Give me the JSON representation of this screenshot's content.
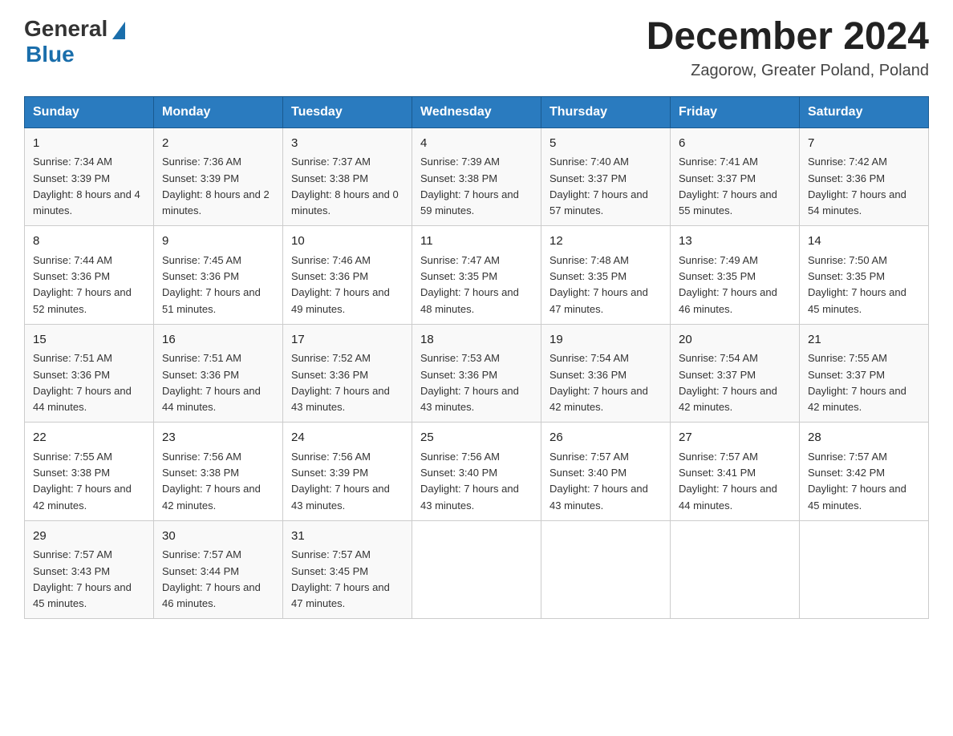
{
  "header": {
    "logo_general": "General",
    "logo_blue": "Blue",
    "title": "December 2024",
    "subtitle": "Zagorow, Greater Poland, Poland"
  },
  "weekdays": [
    "Sunday",
    "Monday",
    "Tuesday",
    "Wednesday",
    "Thursday",
    "Friday",
    "Saturday"
  ],
  "weeks": [
    [
      {
        "day": "1",
        "sunrise": "7:34 AM",
        "sunset": "3:39 PM",
        "daylight": "8 hours and 4 minutes."
      },
      {
        "day": "2",
        "sunrise": "7:36 AM",
        "sunset": "3:39 PM",
        "daylight": "8 hours and 2 minutes."
      },
      {
        "day": "3",
        "sunrise": "7:37 AM",
        "sunset": "3:38 PM",
        "daylight": "8 hours and 0 minutes."
      },
      {
        "day": "4",
        "sunrise": "7:39 AM",
        "sunset": "3:38 PM",
        "daylight": "7 hours and 59 minutes."
      },
      {
        "day": "5",
        "sunrise": "7:40 AM",
        "sunset": "3:37 PM",
        "daylight": "7 hours and 57 minutes."
      },
      {
        "day": "6",
        "sunrise": "7:41 AM",
        "sunset": "3:37 PM",
        "daylight": "7 hours and 55 minutes."
      },
      {
        "day": "7",
        "sunrise": "7:42 AM",
        "sunset": "3:36 PM",
        "daylight": "7 hours and 54 minutes."
      }
    ],
    [
      {
        "day": "8",
        "sunrise": "7:44 AM",
        "sunset": "3:36 PM",
        "daylight": "7 hours and 52 minutes."
      },
      {
        "day": "9",
        "sunrise": "7:45 AM",
        "sunset": "3:36 PM",
        "daylight": "7 hours and 51 minutes."
      },
      {
        "day": "10",
        "sunrise": "7:46 AM",
        "sunset": "3:36 PM",
        "daylight": "7 hours and 49 minutes."
      },
      {
        "day": "11",
        "sunrise": "7:47 AM",
        "sunset": "3:35 PM",
        "daylight": "7 hours and 48 minutes."
      },
      {
        "day": "12",
        "sunrise": "7:48 AM",
        "sunset": "3:35 PM",
        "daylight": "7 hours and 47 minutes."
      },
      {
        "day": "13",
        "sunrise": "7:49 AM",
        "sunset": "3:35 PM",
        "daylight": "7 hours and 46 minutes."
      },
      {
        "day": "14",
        "sunrise": "7:50 AM",
        "sunset": "3:35 PM",
        "daylight": "7 hours and 45 minutes."
      }
    ],
    [
      {
        "day": "15",
        "sunrise": "7:51 AM",
        "sunset": "3:36 PM",
        "daylight": "7 hours and 44 minutes."
      },
      {
        "day": "16",
        "sunrise": "7:51 AM",
        "sunset": "3:36 PM",
        "daylight": "7 hours and 44 minutes."
      },
      {
        "day": "17",
        "sunrise": "7:52 AM",
        "sunset": "3:36 PM",
        "daylight": "7 hours and 43 minutes."
      },
      {
        "day": "18",
        "sunrise": "7:53 AM",
        "sunset": "3:36 PM",
        "daylight": "7 hours and 43 minutes."
      },
      {
        "day": "19",
        "sunrise": "7:54 AM",
        "sunset": "3:36 PM",
        "daylight": "7 hours and 42 minutes."
      },
      {
        "day": "20",
        "sunrise": "7:54 AM",
        "sunset": "3:37 PM",
        "daylight": "7 hours and 42 minutes."
      },
      {
        "day": "21",
        "sunrise": "7:55 AM",
        "sunset": "3:37 PM",
        "daylight": "7 hours and 42 minutes."
      }
    ],
    [
      {
        "day": "22",
        "sunrise": "7:55 AM",
        "sunset": "3:38 PM",
        "daylight": "7 hours and 42 minutes."
      },
      {
        "day": "23",
        "sunrise": "7:56 AM",
        "sunset": "3:38 PM",
        "daylight": "7 hours and 42 minutes."
      },
      {
        "day": "24",
        "sunrise": "7:56 AM",
        "sunset": "3:39 PM",
        "daylight": "7 hours and 43 minutes."
      },
      {
        "day": "25",
        "sunrise": "7:56 AM",
        "sunset": "3:40 PM",
        "daylight": "7 hours and 43 minutes."
      },
      {
        "day": "26",
        "sunrise": "7:57 AM",
        "sunset": "3:40 PM",
        "daylight": "7 hours and 43 minutes."
      },
      {
        "day": "27",
        "sunrise": "7:57 AM",
        "sunset": "3:41 PM",
        "daylight": "7 hours and 44 minutes."
      },
      {
        "day": "28",
        "sunrise": "7:57 AM",
        "sunset": "3:42 PM",
        "daylight": "7 hours and 45 minutes."
      }
    ],
    [
      {
        "day": "29",
        "sunrise": "7:57 AM",
        "sunset": "3:43 PM",
        "daylight": "7 hours and 45 minutes."
      },
      {
        "day": "30",
        "sunrise": "7:57 AM",
        "sunset": "3:44 PM",
        "daylight": "7 hours and 46 minutes."
      },
      {
        "day": "31",
        "sunrise": "7:57 AM",
        "sunset": "3:45 PM",
        "daylight": "7 hours and 47 minutes."
      },
      null,
      null,
      null,
      null
    ]
  ]
}
